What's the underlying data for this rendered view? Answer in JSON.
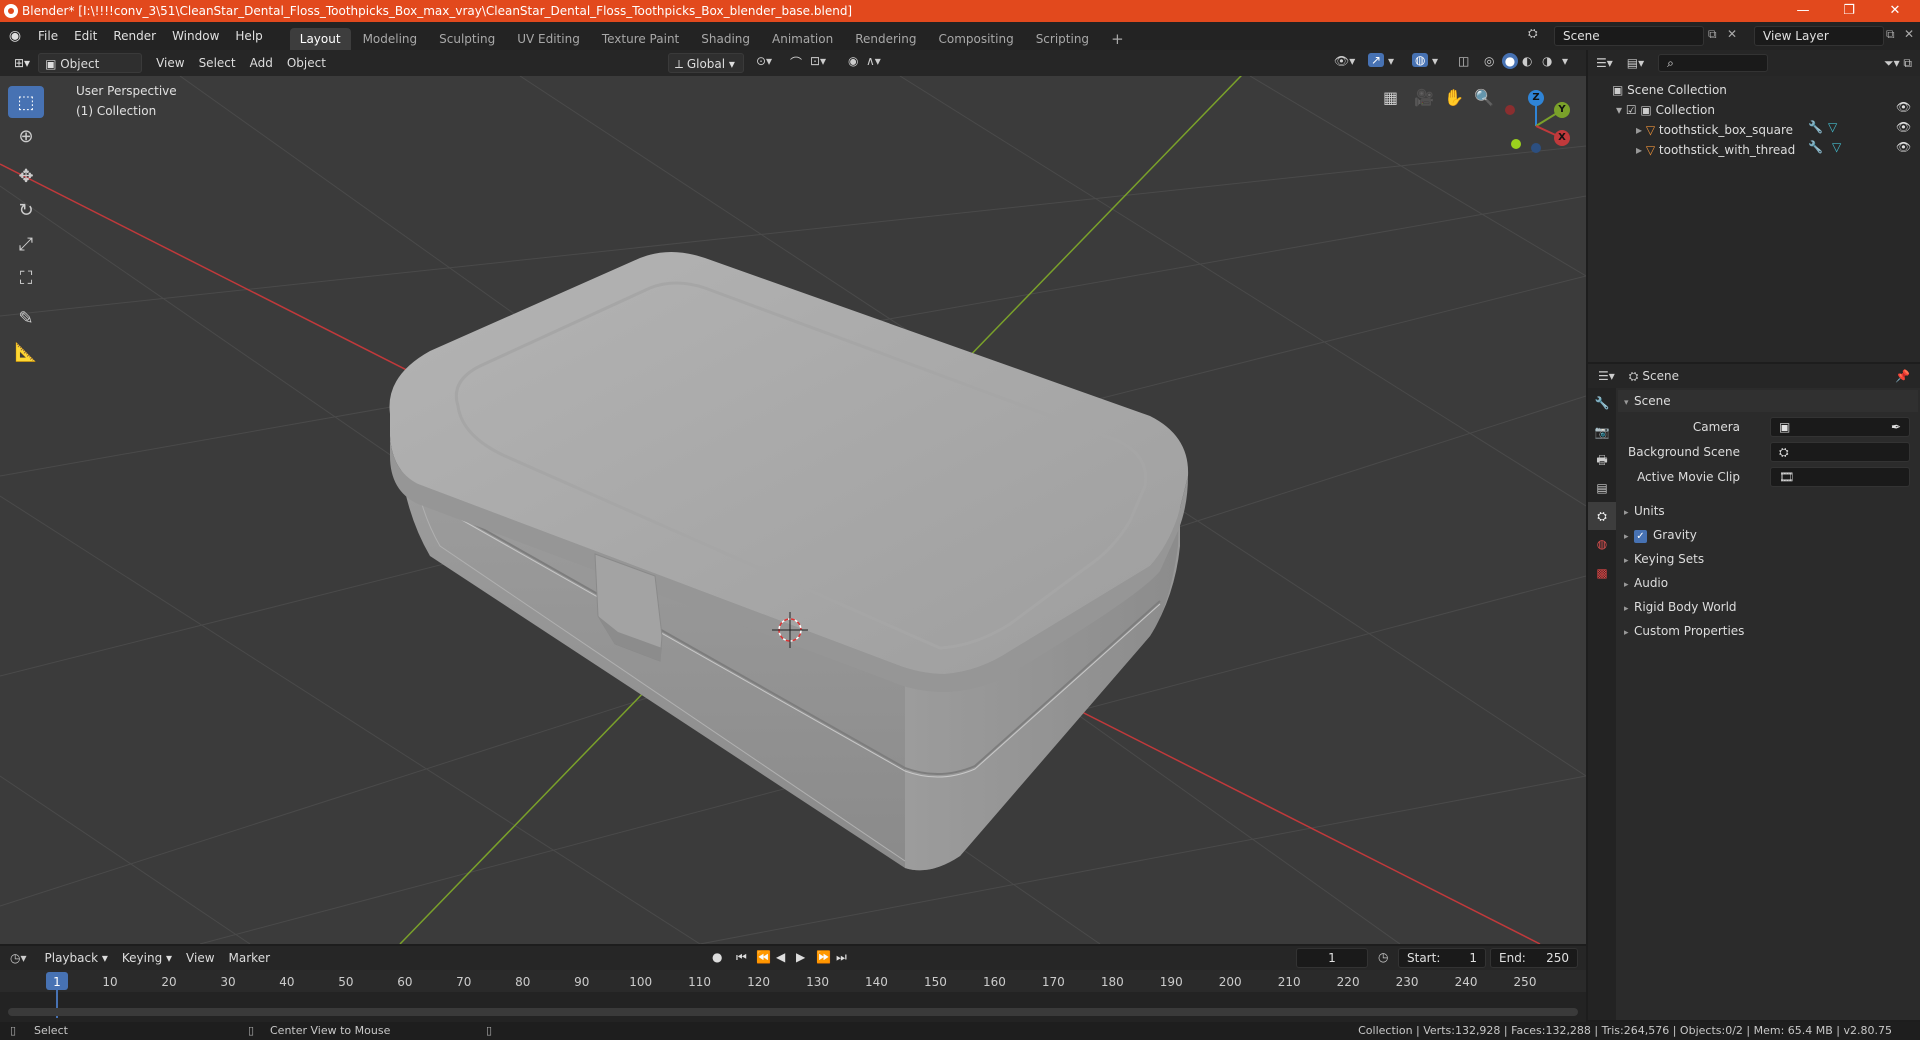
{
  "window": {
    "title": "Blender* [I:\\!!!!conv_3\\51\\CleanStar_Dental_Floss_Toothpicks_Box_max_vray\\CleanStar_Dental_Floss_Toothpicks_Box_blender_base.blend]",
    "minimize": "—",
    "maximize": "❐",
    "close": "✕"
  },
  "menu": [
    "File",
    "Edit",
    "Render",
    "Window",
    "Help"
  ],
  "workspaces": [
    {
      "label": "Layout",
      "active": true
    },
    {
      "label": "Modeling"
    },
    {
      "label": "Sculpting"
    },
    {
      "label": "UV Editing"
    },
    {
      "label": "Texture Paint"
    },
    {
      "label": "Shading"
    },
    {
      "label": "Animation"
    },
    {
      "label": "Rendering"
    },
    {
      "label": "Compositing"
    },
    {
      "label": "Scripting"
    }
  ],
  "add_workspace": "+",
  "scene_field": "Scene",
  "view_layer_field": "View Layer",
  "viewport_header": {
    "mode": "Object Mode",
    "menus": [
      "View",
      "Select",
      "Add",
      "Object"
    ],
    "transform_orientation": "Global"
  },
  "viewport": {
    "perspective_label": "User Perspective",
    "collection_label": "(1) Collection",
    "gizmo": {
      "z": "Z",
      "y": "Y",
      "x": "X"
    }
  },
  "outliner": {
    "root": "Scene Collection",
    "collection": "Collection",
    "objects": [
      "toothstick_box_square",
      "toothstick_with_thread"
    ]
  },
  "properties": {
    "header": "Scene",
    "panel_title": "Scene",
    "fields": [
      {
        "label": "Camera",
        "value": ""
      },
      {
        "label": "Background Scene",
        "value": ""
      },
      {
        "label": "Active Movie Clip",
        "value": ""
      }
    ],
    "sections": [
      {
        "label": "Units"
      },
      {
        "label": "Gravity",
        "checked": true
      },
      {
        "label": "Keying Sets"
      },
      {
        "label": "Audio"
      },
      {
        "label": "Rigid Body World"
      },
      {
        "label": "Custom Properties"
      }
    ]
  },
  "timeline": {
    "menus": [
      "Playback",
      "Keying",
      "View",
      "Marker"
    ],
    "current_frame": "1",
    "start_label": "Start:",
    "start": "1",
    "end_label": "End:",
    "end": "250",
    "ticks": [
      "1",
      "10",
      "20",
      "30",
      "40",
      "50",
      "60",
      "70",
      "80",
      "90",
      "100",
      "110",
      "120",
      "130",
      "140",
      "150",
      "160",
      "170",
      "180",
      "190",
      "200",
      "210",
      "220",
      "230",
      "240",
      "250"
    ]
  },
  "statusbar": {
    "left": "Select",
    "middle": "Center View to Mouse",
    "right": "Collection | Verts:132,928 | Faces:132,288 | Tris:264,576 | Objects:0/2 | Mem: 65.4 MB | v2.80.75"
  },
  "colors": {
    "titlebar": "#e2491d",
    "accent": "#4772b3",
    "x_axis": "#c0393b",
    "y_axis": "#7aa12a",
    "z_axis": "#2f84d6"
  }
}
